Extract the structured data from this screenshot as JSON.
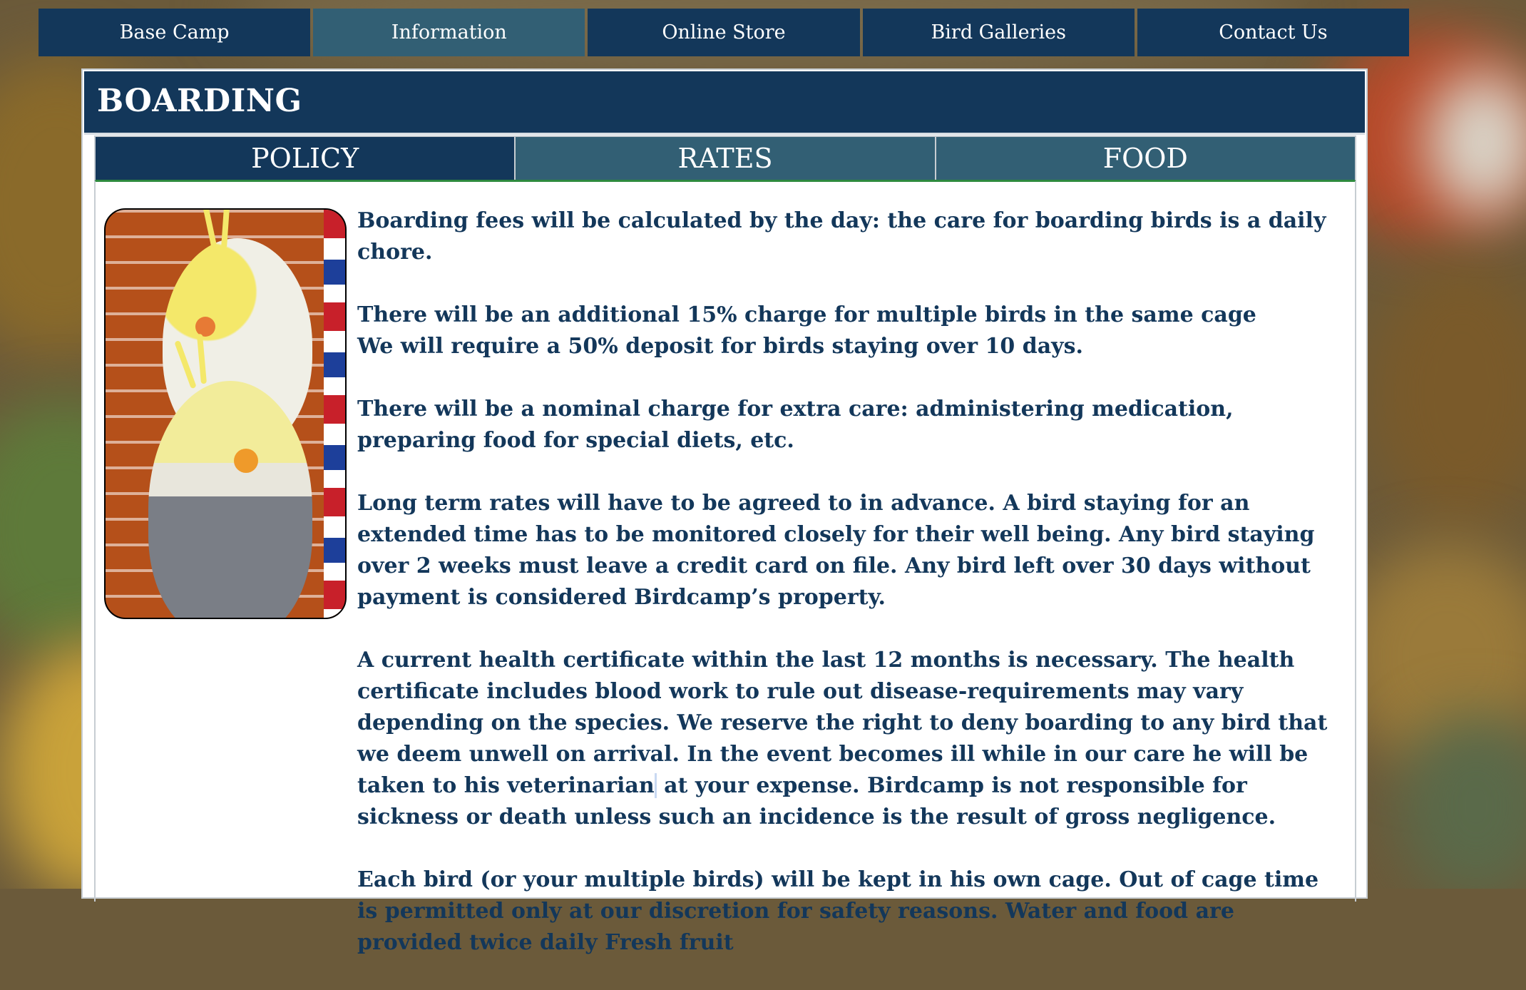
{
  "nav": {
    "items": [
      {
        "label": "Base Camp"
      },
      {
        "label": "Information"
      },
      {
        "label": "Online Store"
      },
      {
        "label": "Bird Galleries"
      },
      {
        "label": "Contact Us"
      }
    ],
    "active": "Information"
  },
  "page": {
    "title": "BOARDING",
    "tabs": [
      {
        "label": "POLICY"
      },
      {
        "label": "RATES"
      },
      {
        "label": "FOOD"
      }
    ],
    "active_tab": "POLICY"
  },
  "policy": {
    "p1": "Boarding fees will be calculated by the day: the care for boarding birds is a daily chore.",
    "p2a": "There will be an additional 15% charge for multiple birds in the same cage",
    "p2b": "We will require a 50% deposit for birds staying over 10 days.",
    "p3": "There will be a nominal charge for extra care: administering medication, preparing food for special diets, etc.",
    "p4": "Long term rates will have to be agreed to in advance.  A bird staying for an extended time has to be monitored closely for their well being.  Any bird staying over 2 weeks must leave a credit card on file.  Any bird left over 30 days without payment is considered Birdcamp’s property.",
    "p5_before": "A current health certificate within the last 12 months is necessary. The health certificate includes blood work to rule out disease-requirements may vary depending on the species. We reserve the right to deny boarding to any bird that we deem unwell on arrival. In the event becomes ill while in our care he will be taken to his veterinarian",
    "p5_after": "at your expense. Birdcamp is not responsible for sickness or death unless such an incidence is the result of gross negligence.",
    "p6": "Each bird (or your multiple birds) will be kept in his own cage. Out of cage time is permitted only at our discretion for safety reasons.  Water and food are provided twice daily Fresh fruit"
  },
  "colors": {
    "navy": "#13375a",
    "teal": "#325f74",
    "tab_underline": "#2e8a3e"
  },
  "photo": {
    "icon": "cockatiels-photo"
  }
}
